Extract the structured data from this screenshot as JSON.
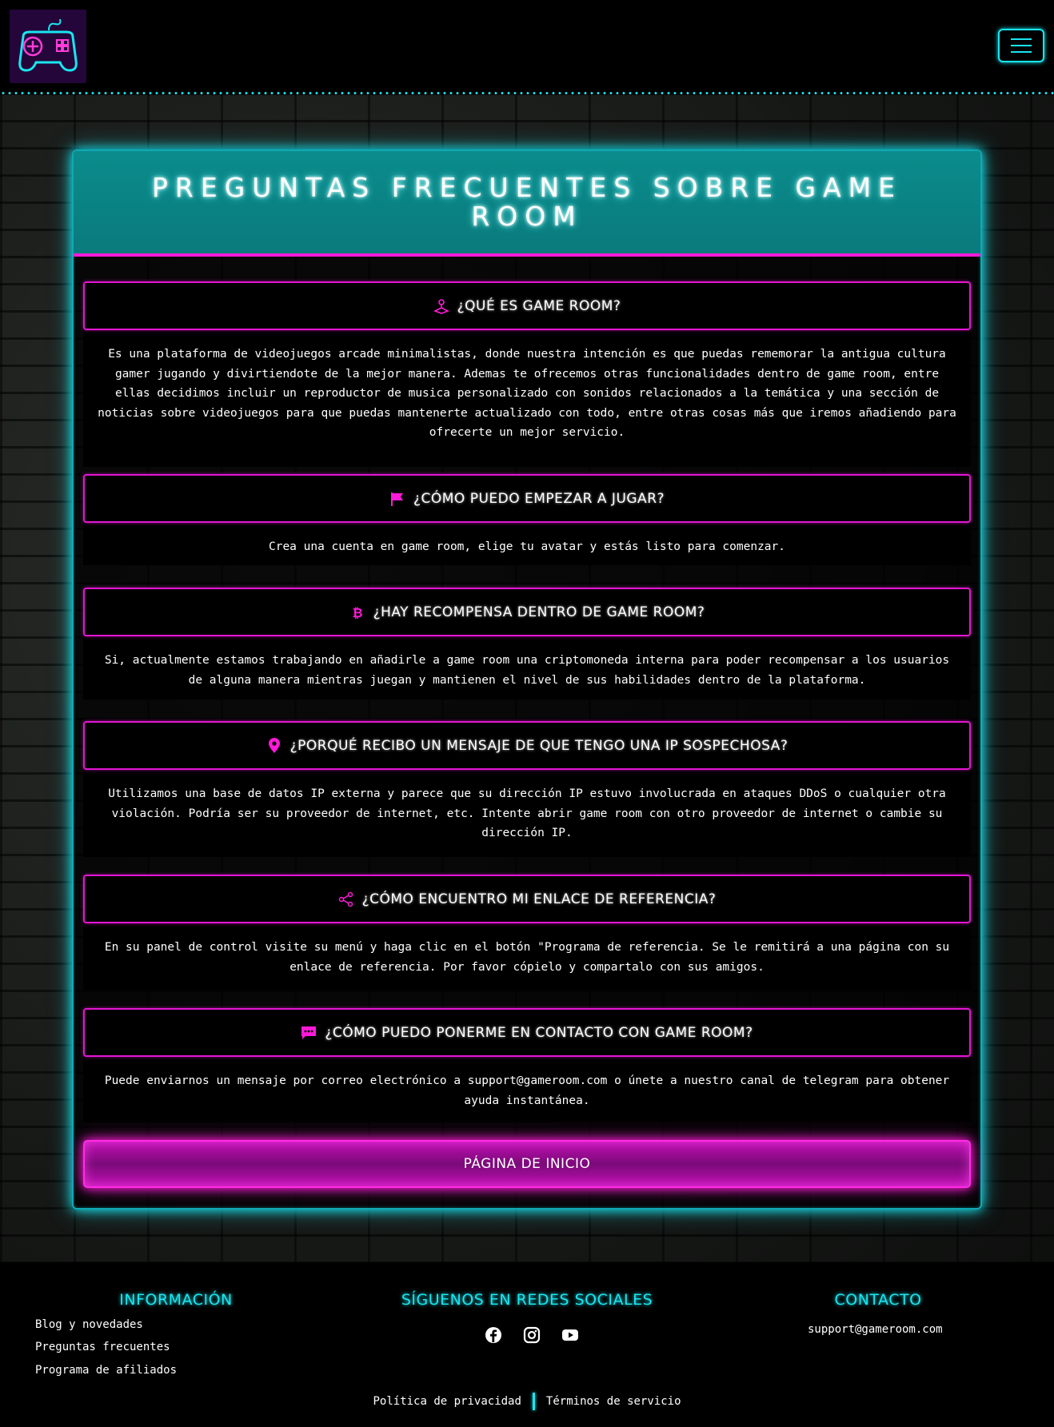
{
  "navbar": {
    "logo_icon": "gamepad-icon",
    "menu_icon": "hamburger-icon"
  },
  "colors": {
    "accent_cyan": "#19e6f0",
    "accent_magenta": "#ff1ad9",
    "header_teal": "#0a7a7d"
  },
  "page": {
    "title": "PREGUNTAS FRECUENTES SOBRE GAME ROOM"
  },
  "faqs": [
    {
      "icon": "joystick-icon",
      "question": "¿QUÉ ES GAME ROOM?",
      "answer": "Es una plataforma de videojuegos arcade minimalistas, donde nuestra intención es que puedas rememorar la antigua cultura gamer jugando y divirtiendote de la mejor manera. Ademas te ofrecemos otras funcionalidades dentro de game room, entre ellas decidimos incluir un reproductor de musica personalizado con sonidos relacionados a la temática y una sección de noticias sobre videojuegos para que puedas mantenerte actualizado con todo, entre otras cosas más que iremos añadiendo para ofrecerte un mejor servicio."
    },
    {
      "icon": "flag-icon",
      "question": "¿CÓMO PUEDO EMPEZAR A JUGAR?",
      "answer": "Crea una cuenta en game room, elige tu avatar y estás listo para comenzar."
    },
    {
      "icon": "bitcoin-icon",
      "question": "¿HAY RECOMPENSA DENTRO DE GAME ROOM?",
      "answer": "Si, actualmente estamos trabajando en añadirle a game room una criptomoneda interna para poder recompensar a los usuarios de alguna manera mientras juegan y mantienen el nivel de sus habilidades dentro de la plataforma."
    },
    {
      "icon": "location-pin-icon",
      "question": "¿PORQUÉ RECIBO UN MENSAJE DE QUE TENGO UNA IP SOSPECHOSA?",
      "answer": "Utilizamos una base de datos IP externa y parece que su dirección IP estuvo involucrada en ataques DDoS o cualquier otra violación. Podría ser su proveedor de internet, etc. Intente abrir game room con otro proveedor de internet o cambie su dirección IP."
    },
    {
      "icon": "share-icon",
      "question": "¿CÓMO ENCUENTRO MI ENLACE DE REFERENCIA?",
      "answer": "En su panel de control visite su menú y haga clic en el botón \"Programa de referencia. Se le remitirá a una página con su enlace de referencia. Por favor cópielo y compartalo con sus amigos."
    },
    {
      "icon": "chat-icon",
      "question": "¿CÓMO PUEDO PONERME EN CONTACTO CON GAME ROOM?",
      "answer": "Puede enviarnos un mensaje por correo electrónico a support@gameroom.com o únete a nuestro canal de telegram para obtener ayuda instantánea."
    }
  ],
  "home_button": "PÁGINA DE INICIO",
  "footer": {
    "info_heading": "INFORMACIÓN",
    "info_links": [
      "Blog y novedades",
      "Preguntas frecuentes",
      "Programa de afiliados"
    ],
    "social_heading": "SÍGUENOS EN REDES SOCIALES",
    "social_icons": [
      "facebook-icon",
      "instagram-icon",
      "youtube-icon"
    ],
    "contact_heading": "CONTACTO",
    "contact_email": "support@gameroom.com",
    "privacy": "Política de privacidad",
    "terms": "Términos de servicio"
  }
}
